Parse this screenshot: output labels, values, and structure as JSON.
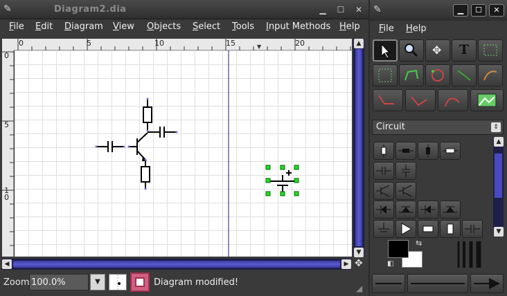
{
  "main_window": {
    "title": "Diagram2.dia",
    "menu": [
      "File",
      "Edit",
      "Diagram",
      "View",
      "Objects",
      "Select",
      "Tools",
      "Input Methods",
      "Help"
    ]
  },
  "rulers": {
    "horizontal_ticks": [
      "0",
      "5",
      "10",
      "15",
      "20"
    ],
    "vertical_ticks": [
      "0",
      "5",
      "10"
    ]
  },
  "statusbar": {
    "zoom_label": "Zoom",
    "zoom_value": "100.0%",
    "status_text": "Diagram modified!"
  },
  "toolbox": {
    "menu": [
      "File",
      "Help"
    ],
    "sheet": "Circuit",
    "fg_color": "#000000",
    "bg_color": "#ffffff"
  }
}
